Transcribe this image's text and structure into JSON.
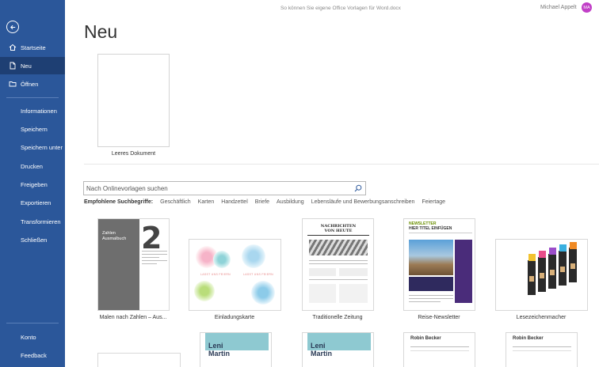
{
  "window": {
    "title": "So können Sie eigene Office Vorlagen für Word.docx",
    "user_name": "Michael Appelt",
    "user_initials": "MA"
  },
  "sidebar": {
    "top_items": [
      {
        "label": "Startseite",
        "icon": "home-icon"
      },
      {
        "label": "Neu",
        "icon": "new-document-icon",
        "active": true
      },
      {
        "label": "Öffnen",
        "icon": "folder-open-icon"
      }
    ],
    "items": [
      "Informationen",
      "Speichern",
      "Speichern unter",
      "Drucken",
      "Freigeben",
      "Exportieren",
      "Transformieren",
      "Schließen"
    ],
    "bottom_items": [
      "Konto",
      "Feedback"
    ]
  },
  "main": {
    "title": "Neu",
    "blank_document_label": "Leeres Dokument",
    "search": {
      "placeholder": "Nach Onlinevorlagen suchen",
      "value": ""
    },
    "suggested_label": "Empfohlene Suchbegriffe:",
    "suggested": [
      "Geschäftlich",
      "Karten",
      "Handzettel",
      "Briefe",
      "Ausbildung",
      "Lebensläufe und Bewerbungsanschreiben",
      "Feiertage"
    ],
    "templates": [
      {
        "label": "Malen nach Zahlen – Aus...",
        "thumb_text": [
          "Zahlen",
          "Ausmalbuch"
        ],
        "thumb_number": "2"
      },
      {
        "label": "Einladungskarte",
        "thumb_text": "LASST UNS FEIERN"
      },
      {
        "label": "Traditionelle Zeitung",
        "thumb_text": [
          "NACHRICHTEN",
          "VON HEUTE"
        ]
      },
      {
        "label": "Reise-Newsletter",
        "thumb_text": [
          "NEWSLETTER",
          "HIER TITEL EINFÜGEN"
        ]
      },
      {
        "label": "Lesezeichenmacher"
      }
    ],
    "row2": [
      {
        "thumb_text": [
          "Leni",
          "Martin"
        ]
      },
      {
        "thumb_text": [
          "Leni",
          "Martin"
        ]
      },
      {
        "thumb_text": "Robin Becker"
      },
      {
        "thumb_text": "Robin Becker"
      }
    ]
  },
  "colors": {
    "sidebar_bg": "#2b579a",
    "sidebar_active": "#1e3f73",
    "avatar_bg": "#c13fc7"
  }
}
